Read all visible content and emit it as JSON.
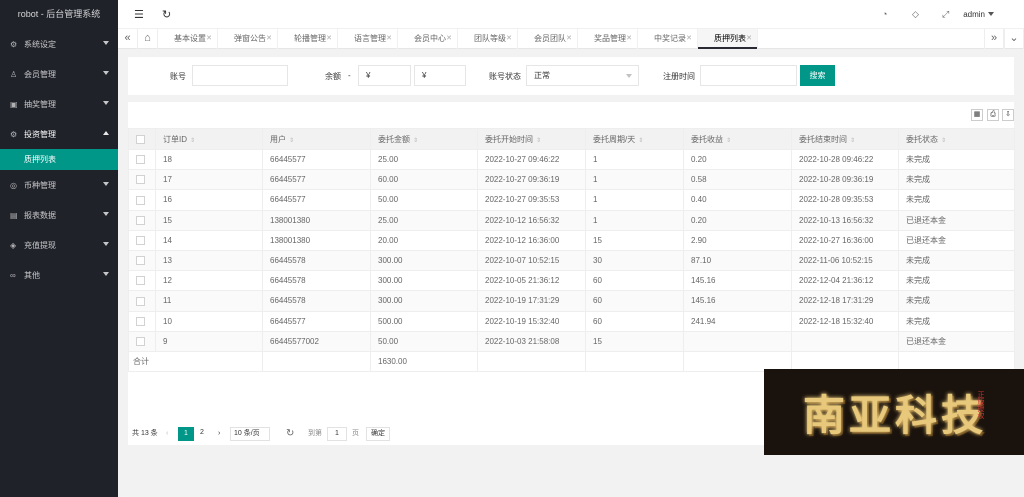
{
  "app": {
    "title": "robot - 后台管理系统"
  },
  "sidebar": {
    "items": [
      {
        "label": "系统设定",
        "icon": "gear-icon",
        "glyph": "⚙"
      },
      {
        "label": "会员管理",
        "icon": "user-icon",
        "glyph": "♙"
      },
      {
        "label": "抽奖管理",
        "icon": "gift-icon",
        "glyph": "▣"
      },
      {
        "label": "投资管理",
        "icon": "settings-icon",
        "glyph": "⚙"
      },
      {
        "label": "币种管理",
        "icon": "coin-icon",
        "glyph": "◎"
      },
      {
        "label": "报表数据",
        "icon": "chart-icon",
        "glyph": "▤"
      },
      {
        "label": "充值提现",
        "icon": "wallet-icon",
        "glyph": "◈"
      },
      {
        "label": "其他",
        "icon": "link-icon",
        "glyph": "∞"
      }
    ],
    "sub_item": "质押列表"
  },
  "header": {
    "user": "admin",
    "icons": [
      "menu-fold-icon",
      "refresh-icon",
      "theme-icon",
      "tag-icon",
      "fullscreen-icon"
    ]
  },
  "tabs": [
    {
      "label": "基本设置"
    },
    {
      "label": "弹窗公告"
    },
    {
      "label": "轮播管理"
    },
    {
      "label": "语言管理"
    },
    {
      "label": "会员中心"
    },
    {
      "label": "团队等级"
    },
    {
      "label": "会员团队"
    },
    {
      "label": "奖品管理"
    },
    {
      "label": "中奖记录"
    },
    {
      "label": "质押列表"
    }
  ],
  "filter": {
    "account_label": "账号",
    "account_value": "",
    "balance_label": "余额",
    "balance_dash": "-",
    "currency_symbol": "¥",
    "status_label": "账号状态",
    "status_value": "正常",
    "reg_time_label": "注册时间",
    "reg_time_value": "",
    "search_button": "搜索"
  },
  "table": {
    "headers": [
      "订单ID",
      "用户",
      "委托金额",
      "委托开始时间",
      "委托周期/天",
      "委托收益",
      "委托结束时间",
      "委托状态"
    ],
    "rows": [
      [
        "18",
        "66445577",
        "25.00",
        "2022-10-27 09:46:22",
        "1",
        "0.20",
        "2022-10-28 09:46:22",
        "未完成"
      ],
      [
        "17",
        "66445577",
        "60.00",
        "2022-10-27 09:36:19",
        "1",
        "0.58",
        "2022-10-28 09:36:19",
        "未完成"
      ],
      [
        "16",
        "66445577",
        "50.00",
        "2022-10-27 09:35:53",
        "1",
        "0.40",
        "2022-10-28 09:35:53",
        "未完成"
      ],
      [
        "15",
        "138001380",
        "25.00",
        "2022-10-12 16:56:32",
        "1",
        "0.20",
        "2022-10-13 16:56:32",
        "已退还本金"
      ],
      [
        "14",
        "138001380",
        "20.00",
        "2022-10-12 16:36:00",
        "15",
        "2.90",
        "2022-10-27 16:36:00",
        "已退还本金"
      ],
      [
        "13",
        "66445578",
        "300.00",
        "2022-10-07 10:52:15",
        "30",
        "87.10",
        "2022-11-06 10:52:15",
        "未完成"
      ],
      [
        "12",
        "66445578",
        "300.00",
        "2022-10-05 21:36:12",
        "60",
        "145.16",
        "2022-12-04 21:36:12",
        "未完成"
      ],
      [
        "11",
        "66445578",
        "300.00",
        "2022-10-19 17:31:29",
        "60",
        "145.16",
        "2022-12-18 17:31:29",
        "未完成"
      ],
      [
        "10",
        "66445577",
        "500.00",
        "2022-10-19 15:32:40",
        "60",
        "241.94",
        "2022-12-18 15:32:40",
        "未完成"
      ],
      [
        "9",
        "66445577002",
        "50.00",
        "2022-10-03 21:58:08",
        "15",
        "",
        "",
        "已退还本金"
      ]
    ],
    "total_label": "合计",
    "total_amount": "1630.00"
  },
  "pager": {
    "total": "共 13 条",
    "pages": [
      "1",
      "2"
    ],
    "current_page": "1",
    "per_page": "10 条/页",
    "goto_label": "到第",
    "goto_value": "1",
    "page_unit": "页",
    "confirm": "确定"
  },
  "watermark": {
    "text": "南亚科技",
    "sub": "正版授权"
  },
  "colors": {
    "accent": "#009688",
    "sidebar": "#20222a"
  }
}
